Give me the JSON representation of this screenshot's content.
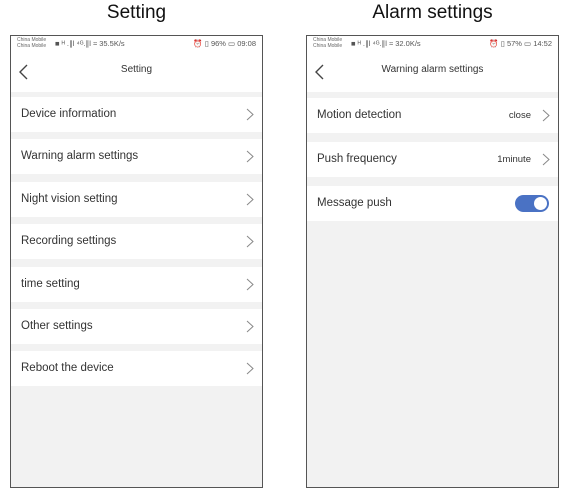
{
  "captions": {
    "left": "Setting",
    "right": "Alarm settings"
  },
  "left_phone": {
    "status": {
      "carrier1": "China Mobile",
      "carrier2": "China Mobile",
      "left": "■ ᴴ .∥l ⁴ᴳ.∥l ≈ 35.5K/s",
      "right": "⏰ ▯ 96% ▭ 09:08"
    },
    "title": "Setting",
    "items": [
      {
        "label": "Device information"
      },
      {
        "label": "Warning alarm settings"
      },
      {
        "label": "Night vision setting"
      },
      {
        "label": "Recording settings"
      },
      {
        "label": "time setting"
      },
      {
        "label": "Other settings"
      },
      {
        "label": "Reboot the device"
      }
    ]
  },
  "right_phone": {
    "status": {
      "carrier1": "China Mobile",
      "carrier2": "China Mobile",
      "left": "■ ᴴ .∥l ⁴ᴳ.∥l ≈ 32.0K/s",
      "right": "⏰ ▯ 57% ▭ 14:52"
    },
    "title": "Warning alarm settings",
    "motion": {
      "label": "Motion detection",
      "value": "close"
    },
    "push_freq": {
      "label": "Push frequency",
      "value": "1minute"
    },
    "message_push": {
      "label": "Message push",
      "enabled": true
    }
  },
  "colors": {
    "toggle_on": "#4a72c4",
    "background": "#f2f2f2"
  },
  "icons": [
    "back-icon",
    "chevron-right-icon",
    "toggle-switch"
  ]
}
